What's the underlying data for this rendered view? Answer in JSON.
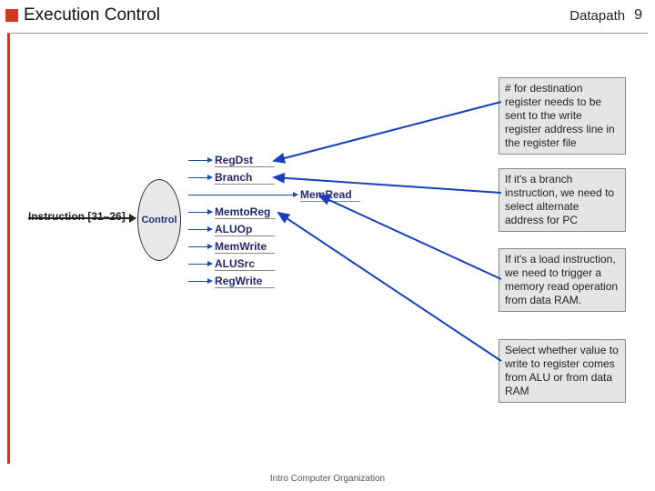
{
  "header": {
    "title": "Execution Control",
    "section": "Datapath",
    "page": "9"
  },
  "diagram": {
    "input_label": "Instruction [31–26]",
    "control_label": "Control",
    "signals": [
      "RegDst",
      "Branch",
      "MemRead",
      "MemtoReg",
      "ALUOp",
      "MemWrite",
      "ALUSrc",
      "RegWrite"
    ]
  },
  "callouts": {
    "c1": "# for destination register needs to be sent to the write register address line in the register file",
    "c2": "If it's a branch instruction, we need to select alternate address for PC",
    "c3": "If it's a load instruction, we need to trigger a memory read operation from data RAM.",
    "c4": "Select whether value to write to register comes from ALU or from data RAM"
  },
  "footer": "Intro Computer Organization"
}
